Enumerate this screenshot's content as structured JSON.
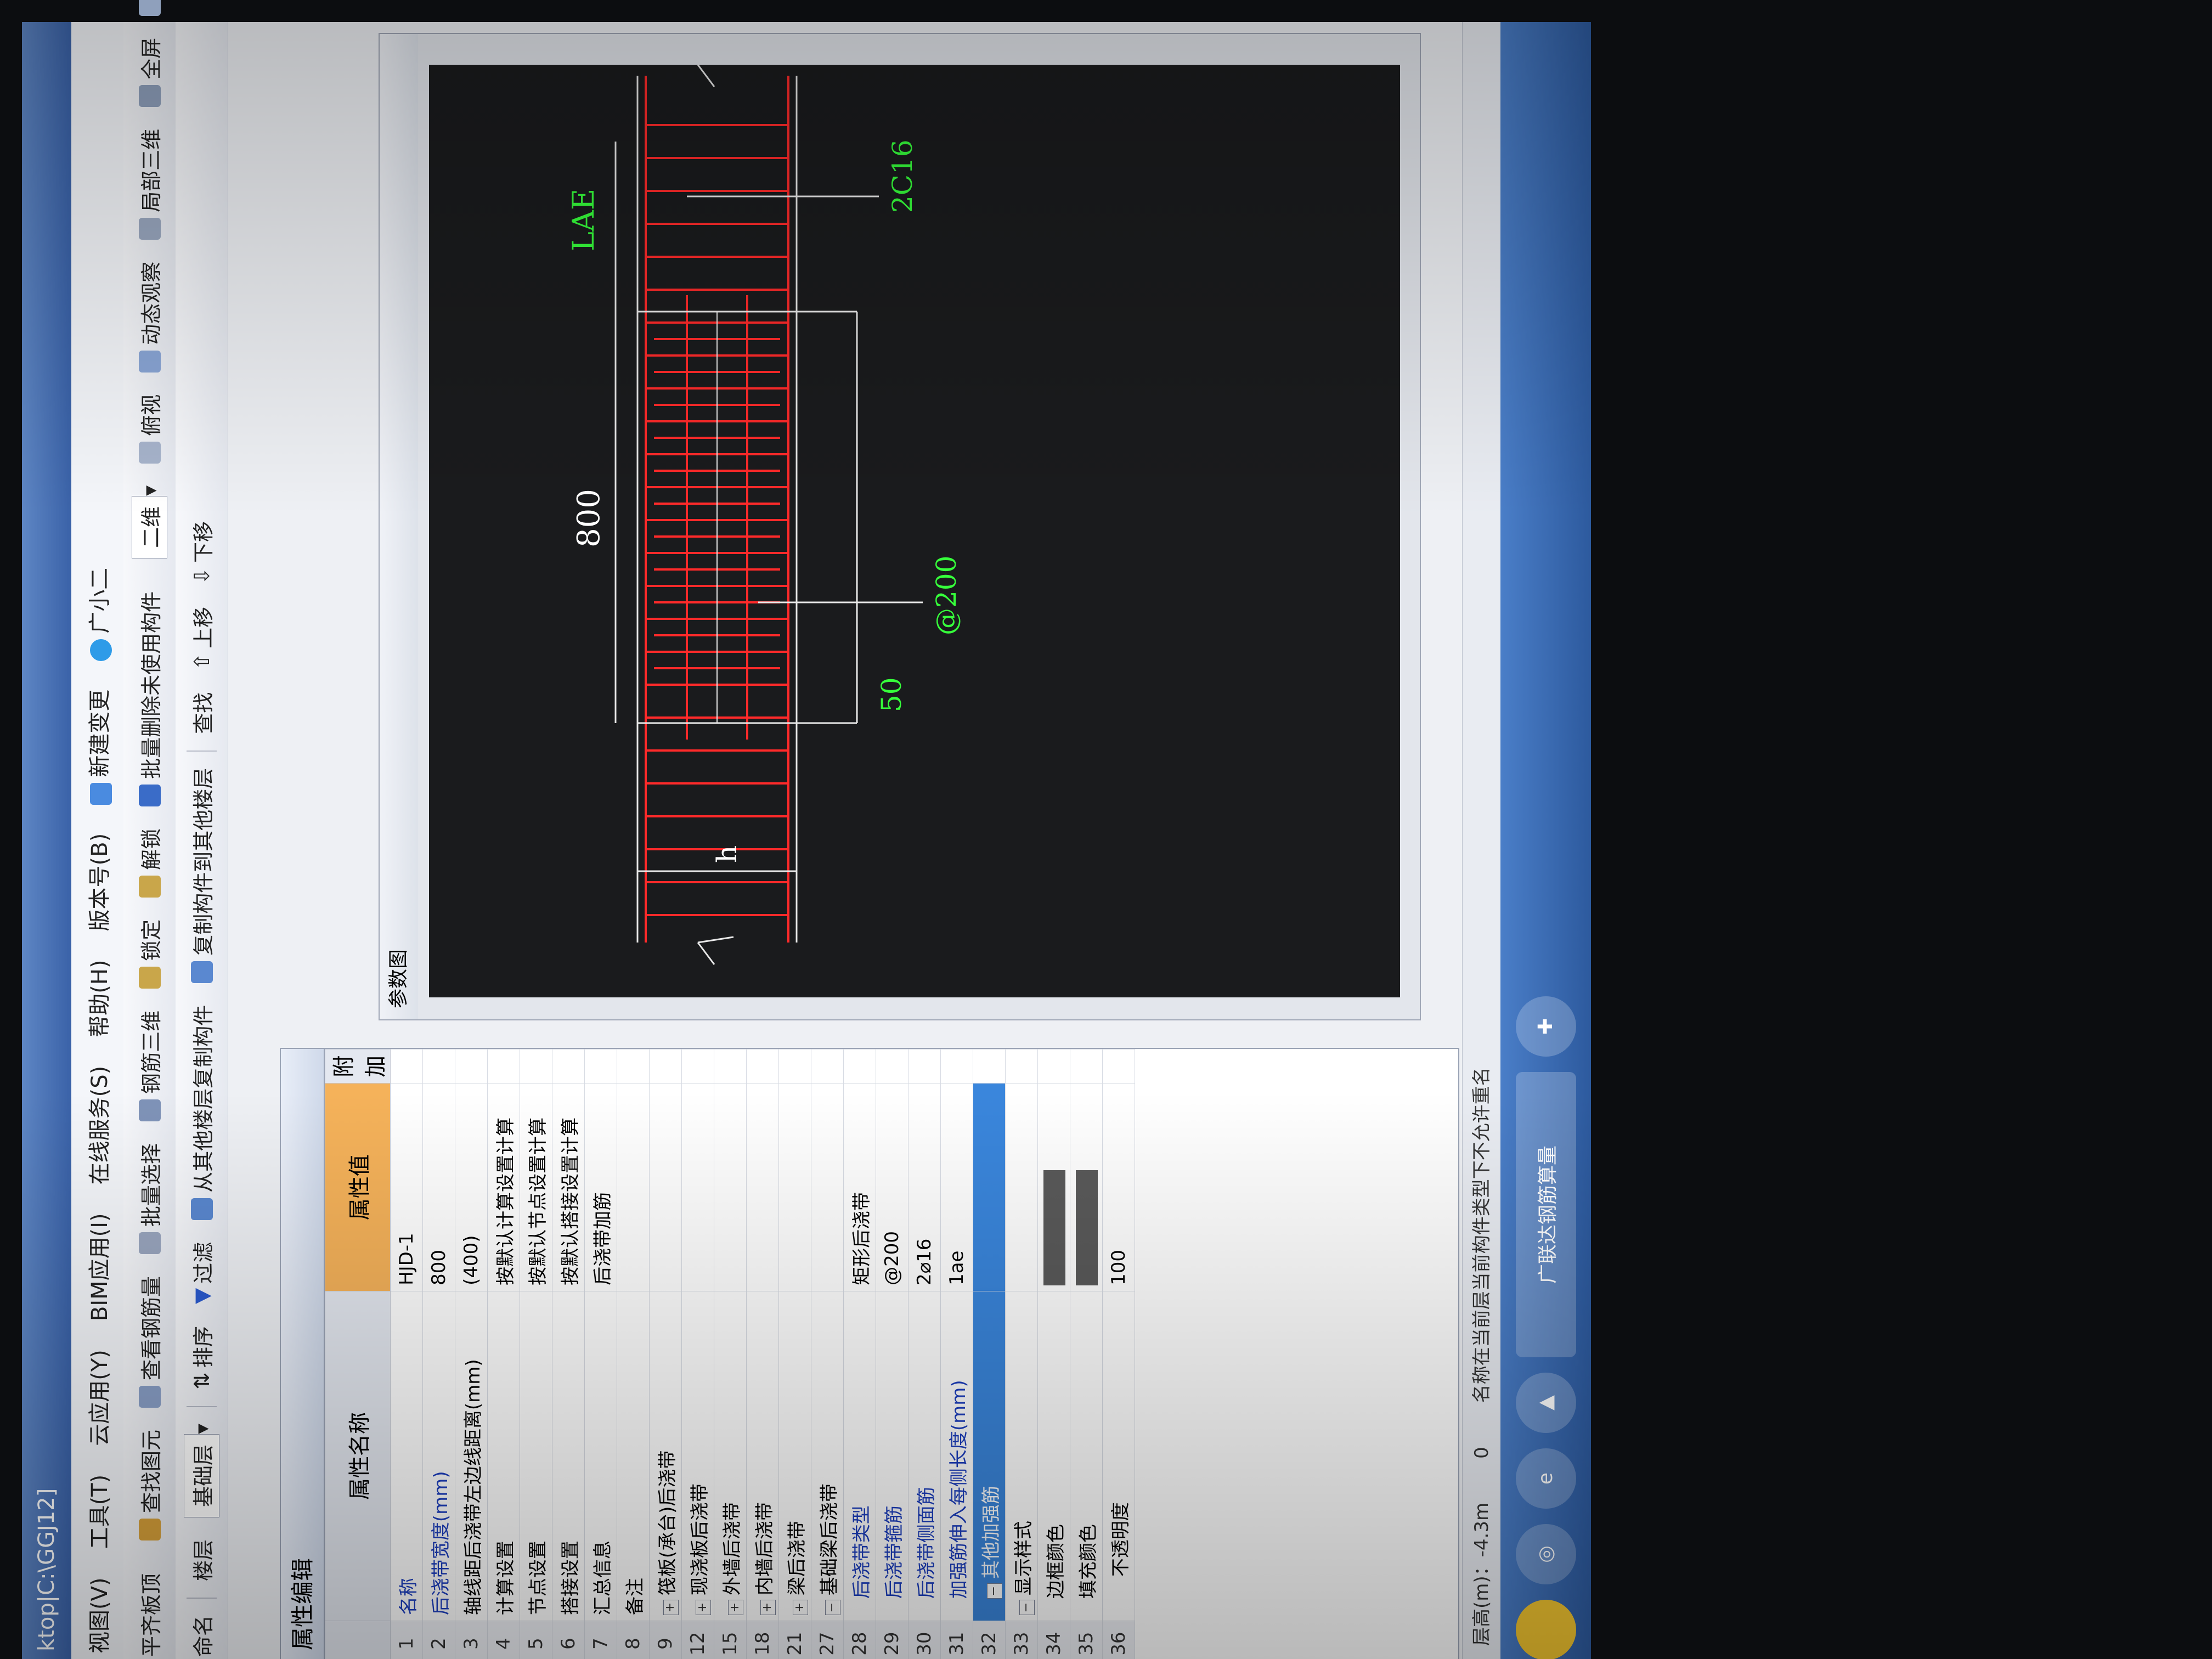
{
  "window": {
    "title": "ktop|C:\\GGJ12]"
  },
  "menu": [
    "视图(V)",
    "工具(T)",
    "云应用(Y)",
    "BIM应用(I)",
    "在线服务(S)",
    "帮助(H)",
    "版本号(B)",
    "新建变更",
    "广小二"
  ],
  "toolbar1": [
    "平齐板顶",
    "查找图元",
    "查看钢筋量",
    "批量选择",
    "钢筋三维",
    "锁定",
    "解锁",
    "批量删除未使用构件",
    "二维",
    "俯视",
    "动态观察",
    "局部三维",
    "全屏",
    "缩放"
  ],
  "toolbar2": [
    "命名",
    "楼层",
    "基础层",
    "排序",
    "过滤",
    "从其他楼层复制构件",
    "复制构件到其他楼层",
    "查找",
    "上移",
    "下移"
  ],
  "property_panel": {
    "tab": "属性编辑",
    "headers": {
      "name": "属性名称",
      "value": "属性值",
      "extra": "附加"
    },
    "rows": [
      {
        "num": "1",
        "name": "名称",
        "value": "HJD-1",
        "style": "blue"
      },
      {
        "num": "2",
        "name": "后浇带宽度(mm)",
        "value": "800",
        "style": "blue"
      },
      {
        "num": "3",
        "name": "轴线距后浇带左边线距离(mm)",
        "value": "(400)",
        "style": ""
      },
      {
        "num": "4",
        "name": "计算设置",
        "value": "按默认计算设置计算",
        "style": ""
      },
      {
        "num": "5",
        "name": "节点设置",
        "value": "按默认节点设置计算",
        "style": ""
      },
      {
        "num": "6",
        "name": "搭接设置",
        "value": "按默认搭接设置计算",
        "style": ""
      },
      {
        "num": "7",
        "name": "汇总信息",
        "value": "后浇带加筋",
        "style": ""
      },
      {
        "num": "8",
        "name": "备注",
        "value": "",
        "style": ""
      },
      {
        "num": "9",
        "name": "筏板(承台)后浇带",
        "value": "",
        "style": "group"
      },
      {
        "num": "12",
        "name": "现浇板后浇带",
        "value": "",
        "style": "group"
      },
      {
        "num": "15",
        "name": "外墙后浇带",
        "value": "",
        "style": "group"
      },
      {
        "num": "18",
        "name": "内墙后浇带",
        "value": "",
        "style": "group"
      },
      {
        "num": "21",
        "name": "梁后浇带",
        "value": "",
        "style": "group"
      },
      {
        "num": "27",
        "name": "基础梁后浇带",
        "value": "",
        "style": "group-open"
      },
      {
        "num": "28",
        "name": "后浇带类型",
        "value": "矩形后浇带",
        "style": "blue-ind"
      },
      {
        "num": "29",
        "name": "后浇带箍筋",
        "value": "@200",
        "style": "blue-ind"
      },
      {
        "num": "30",
        "name": "后浇带侧面筋",
        "value": "2⌀16",
        "style": "blue-ind"
      },
      {
        "num": "31",
        "name": "加强筋伸入每侧长度(mm)",
        "value": "1ae",
        "style": "blue-ind"
      },
      {
        "num": "32",
        "name": "其他加强筋",
        "value": "",
        "style": "selected"
      },
      {
        "num": "33",
        "name": "显示样式",
        "value": "",
        "style": "group-open"
      },
      {
        "num": "34",
        "name": "边框颜色",
        "value": "",
        "style": "swatch"
      },
      {
        "num": "35",
        "name": "填充颜色",
        "value": "",
        "style": "swatch"
      },
      {
        "num": "36",
        "name": "不透明度",
        "value": "100",
        "style": "ind2"
      }
    ]
  },
  "reference_diagram": {
    "title": "参数图",
    "labels": {
      "lae": "LAE",
      "rebar": "2C16",
      "width": "800",
      "spacing": "@200",
      "offset": "50",
      "height": "h"
    },
    "colors": {
      "background": "#1a1b1d",
      "rebar": "#ff2a2a",
      "dimension": "#e8e8e8",
      "label": "#36ff3b"
    }
  },
  "statusbar": {
    "floor": "层高(m)：-4.3m",
    "elevation": "0",
    "hint": "名称在当前层当前构件类型下不允许重名"
  },
  "taskbar": {
    "active_window": "广联达钢筋算量"
  }
}
